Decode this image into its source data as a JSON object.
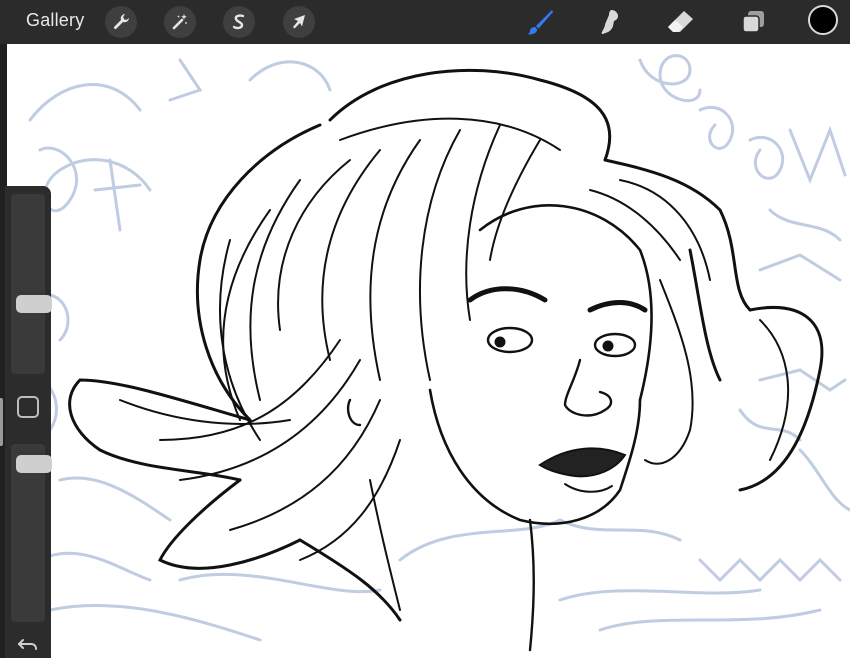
{
  "topbar": {
    "gallery_label": "Gallery",
    "left_tools": [
      "wrench-icon",
      "magic-wand-icon",
      "selection-s-icon",
      "transform-arrow-icon"
    ],
    "right_tools": [
      "brush-icon",
      "smudge-icon",
      "eraser-icon",
      "layers-icon"
    ],
    "active_tool": "brush",
    "current_color": "#000000"
  },
  "sidebar": {
    "brush_size_level": 0.37,
    "opacity_level": 0.95
  },
  "colors": {
    "toolbar_bg": "#2b2b2b",
    "active_tool_accent": "#2f7cf6",
    "sketch_lines": "#b9c7df",
    "ink": "#111111"
  }
}
